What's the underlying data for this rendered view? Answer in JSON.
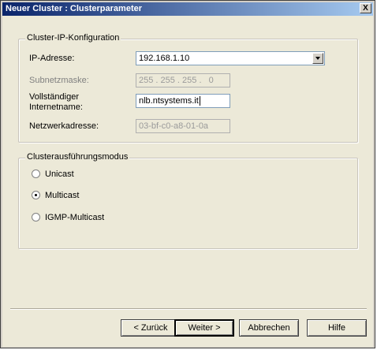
{
  "window": {
    "title": "Neuer Cluster : Clusterparameter",
    "close_glyph": "X"
  },
  "ip_config": {
    "legend": "Cluster-IP-Konfiguration",
    "ip_label": "IP-Adresse:",
    "ip_value": "192.168.1.10",
    "subnet_label": "Subnetzmaske:",
    "subnet_value": "255 . 255 . 255 .   0",
    "fqdn_label": "Vollständiger Internetname:",
    "fqdn_value": "nlb.ntsystems.it",
    "netaddr_label": "Netzwerkadresse:",
    "netaddr_value": "03-bf-c0-a8-01-0a"
  },
  "mode": {
    "legend": "Clusterausführungsmodus",
    "options": [
      {
        "label": "Unicast",
        "checked": false
      },
      {
        "label": "Multicast",
        "checked": true
      },
      {
        "label": "IGMP-Multicast",
        "checked": false
      }
    ]
  },
  "buttons": {
    "back": "< Zurück",
    "next": "Weiter >",
    "cancel": "Abbrechen",
    "help": "Hilfe"
  }
}
